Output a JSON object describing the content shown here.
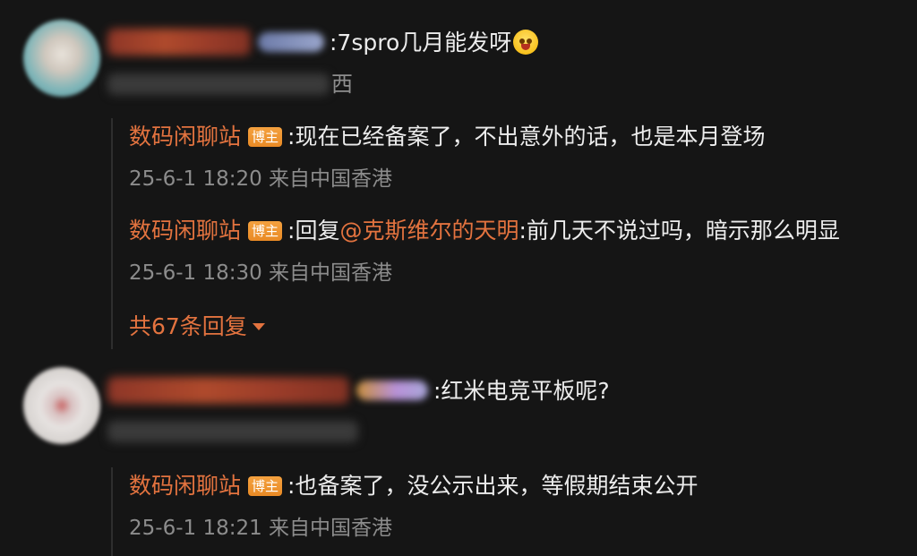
{
  "comments": [
    {
      "text": ":7spro几月能发呀",
      "emoji_icon": "screaming-face-icon",
      "subtext_tail": "西",
      "replies": [
        {
          "author": "数码闲聊站",
          "badge": "博主",
          "text": ":现在已经备案了，不出意外的话，也是本月登场",
          "meta": "25-6-1 18:20 来自中国香港"
        },
        {
          "author": "数码闲聊站",
          "badge": "博主",
          "prefix": ":回复",
          "mention": "@克斯维尔的天明",
          "text": ":前几天不说过吗，暗示那么明显",
          "meta": "25-6-1 18:30 来自中国香港"
        }
      ],
      "more_replies": "共67条回复"
    },
    {
      "text": ":红米电竞平板呢?",
      "replies": [
        {
          "author": "数码闲聊站",
          "badge": "博主",
          "text": ":也备案了，没公示出来，等假期结束公开",
          "meta": "25-6-1 18:21 来自中国香港"
        }
      ]
    }
  ],
  "colors": {
    "background": "#151515",
    "author": "#e3733f",
    "badge": "#ee9330",
    "text": "#ececec",
    "meta": "#8c8c8c"
  }
}
